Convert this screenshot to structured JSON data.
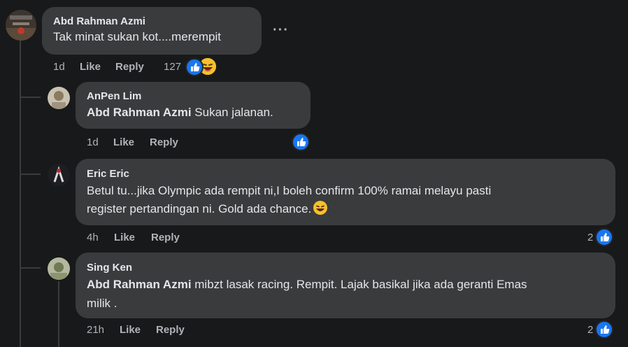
{
  "comments": [
    {
      "author": "Abd Rahman Azmi",
      "text": "Tak minat sukan kot....merempit",
      "time": "1d",
      "like_label": "Like",
      "reply_label": "Reply",
      "reaction_count": "127"
    }
  ],
  "replies": [
    {
      "author": "AnPen Lim",
      "mention": "Abd Rahman Azmi",
      "text": " Sukan jalanan.",
      "time": "1d",
      "like_label": "Like",
      "reply_label": "Reply"
    },
    {
      "author": "Eric Eric",
      "line1": "Betul tu...jika Olympic ada rempit ni,I boleh confirm 100% ramai melayu pasti",
      "line2": "register pertandingan ni. Gold ada chance.",
      "time": "4h",
      "like_label": "Like",
      "reply_label": "Reply",
      "reaction_count": "2"
    },
    {
      "author": "Sing Ken",
      "mention": "Abd Rahman Azmi",
      "line1": " mibzt lasak racing. Rempit. Lajak basikal jika ada geranti Emas",
      "line2": "milik .",
      "time": "21h",
      "like_label": "Like",
      "reply_label": "Reply",
      "reaction_count": "2"
    }
  ],
  "icons": {
    "like": "thumbs-up-icon",
    "haha": "grinning-face-icon",
    "more": "more-options-icon"
  },
  "colors": {
    "background": "#18191a",
    "bubble": "#3a3b3c",
    "like_blue": "#1877f2",
    "secondary_text": "#b0b3b8"
  }
}
